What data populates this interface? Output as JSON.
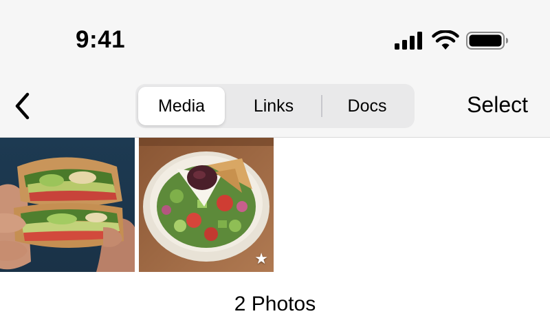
{
  "status_bar": {
    "time": "9:41",
    "icons": [
      "cellular-signal-icon",
      "wifi-icon",
      "battery-icon"
    ]
  },
  "nav": {
    "back_icon": "chevron-left-icon",
    "tabs": [
      {
        "label": "Media",
        "selected": true
      },
      {
        "label": "Links",
        "selected": false
      },
      {
        "label": "Docs",
        "selected": false
      }
    ],
    "select_label": "Select"
  },
  "media": {
    "items": [
      {
        "subject": "sandwich wrap photo",
        "favorite": false
      },
      {
        "subject": "salad bowl photo",
        "favorite": true
      }
    ],
    "favorite_icon": "star-icon",
    "count_label": "2 Photos"
  },
  "colors": {
    "chrome_background": "#f6f6f6",
    "segment_track": "#e9e9ea",
    "segment_selected": "#ffffff"
  }
}
